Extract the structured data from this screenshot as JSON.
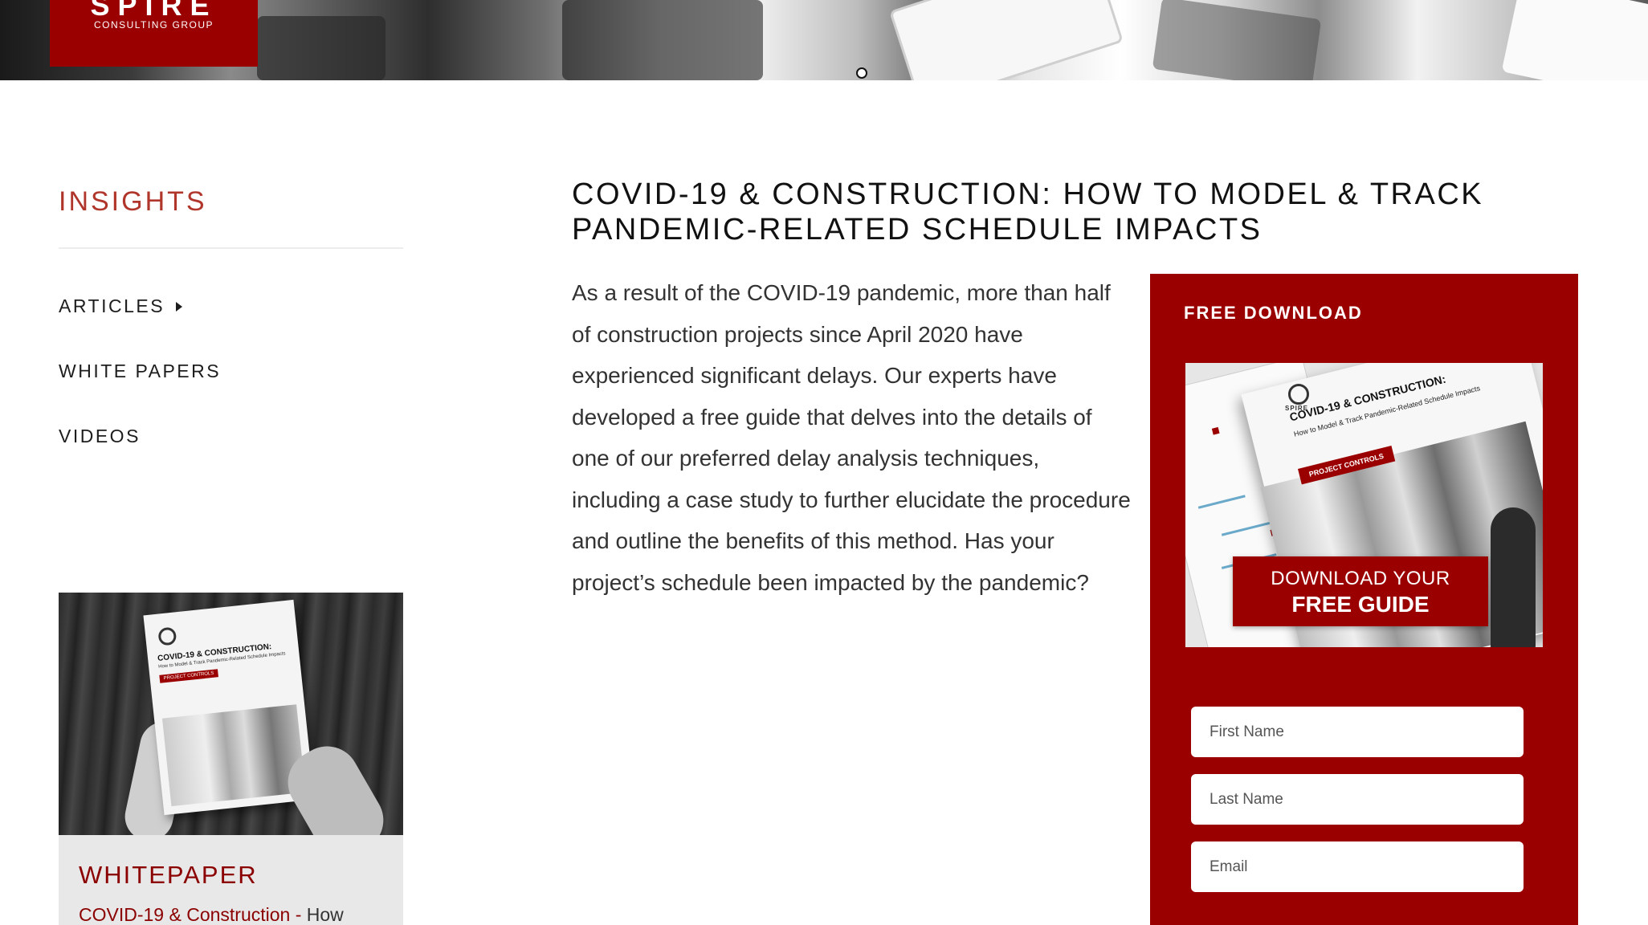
{
  "brand": {
    "logo_mark": "SPIRE",
    "logo_sub": "CONSULTING GROUP"
  },
  "sidebar": {
    "title": "INSIGHTS",
    "items": [
      {
        "label": "ARTICLES"
      },
      {
        "label": "WHITE PAPERS"
      },
      {
        "label": "VIDEOS"
      }
    ],
    "promo": {
      "label": "WHITEPAPER",
      "link_highlight": "COVID-19 & Construction - ",
      "link_rest": "How",
      "book_title": "COVID-19 & CONSTRUCTION:",
      "book_subtitle": "How to Model & Track Pandemic-Related Schedule Impacts",
      "book_tag": "PROJECT CONTROLS"
    }
  },
  "main": {
    "title": "COVID-19 & CONSTRUCTION: HOW TO MODEL & TRACK PANDEMIC-RELATED SCHEDULE IMPACTS",
    "body": "As a result of the COVID-19 pandemic, more than half of construction projects since April 2020 have experienced significant delays. Our experts have developed a free guide that delves into the details of one of our preferred delay analysis techniques, including a case study to further elucidate the procedure and outline the benefits of this method. Has your project’s schedule been impacted by the pandemic?"
  },
  "download": {
    "title": "FREE DOWNLOAD",
    "cover": {
      "logo_text": "SPIRE",
      "title": "COVID-19 & CONSTRUCTION:",
      "subtitle": "How to Model & Track Pandemic-Related Schedule Impacts",
      "tag": "PROJECT CONTROLS",
      "cta_line1": "DOWNLOAD YOUR",
      "cta_line2": "FREE GUIDE"
    },
    "fields": {
      "first_name_placeholder": "First Name",
      "last_name_placeholder": "Last Name",
      "email_placeholder": "Email"
    }
  },
  "colors": {
    "brand_red": "#9b0000",
    "insights_red": "#b0362b",
    "text": "#333333"
  },
  "icons": {
    "articles_expand": "caret-right-icon"
  }
}
